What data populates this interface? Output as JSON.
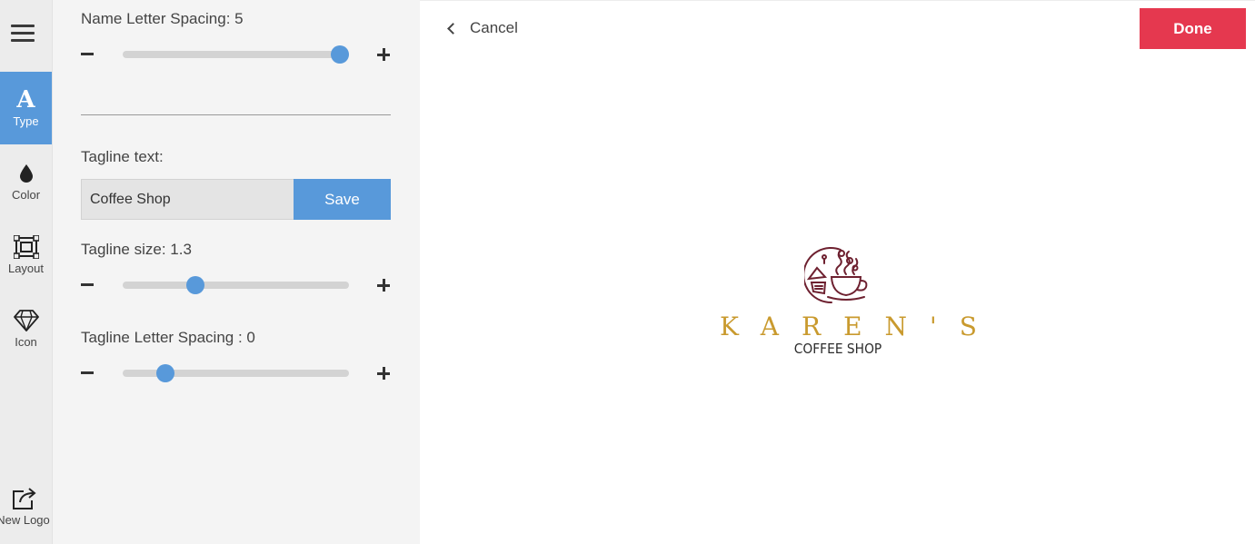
{
  "rail": {
    "items": [
      {
        "label": "Type",
        "icon": "type-icon",
        "active": true
      },
      {
        "label": "Color",
        "icon": "drop-icon",
        "active": false
      },
      {
        "label": "Layout",
        "icon": "layout-icon",
        "active": false
      },
      {
        "label": "Icon",
        "icon": "diamond-icon",
        "active": false
      }
    ],
    "new_logo_label": "New Logo"
  },
  "panel": {
    "name_letter_spacing": {
      "label": "Name Letter Spacing: 5",
      "position": 0.96
    },
    "tagline_text": {
      "label": "Tagline text:",
      "value": "Coffee Shop",
      "save_label": "Save"
    },
    "tagline_size": {
      "label": "Tagline size: 1.3",
      "position": 0.32
    },
    "tagline_letter_spacing": {
      "label": "Tagline Letter Spacing : 0",
      "position": 0.19
    }
  },
  "preview": {
    "cancel_label": "Cancel",
    "done_label": "Done",
    "logo_name": "KAREN'S",
    "logo_tagline": "COFFEE SHOP"
  },
  "colors": {
    "accent_blue": "#5899da",
    "done_red": "#e5384f",
    "logo_gold": "#c99a2e",
    "logo_maroon": "#6e2130"
  }
}
